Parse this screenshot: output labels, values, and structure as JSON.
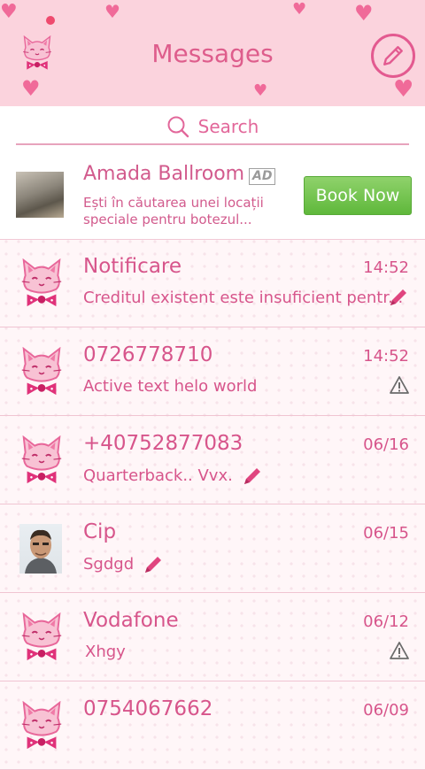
{
  "header": {
    "title": "Messages"
  },
  "search": {
    "placeholder": "Search"
  },
  "ad": {
    "title": "Amada Ballroom",
    "badge": "AD",
    "description": "Ești în căutarea unei locații speciale pentru botezul...",
    "button_label": "Book Now"
  },
  "conversations": [
    {
      "name": "Notificare",
      "time": "14:52",
      "snippet": "Creditul existent este insuficient pentr...",
      "avatar": "cat-avatar",
      "status": "draft-pencil-icon"
    },
    {
      "name": "0726778710",
      "time": "14:52",
      "snippet": "Active text helo world",
      "avatar": "cat-avatar",
      "status": "warning-icon"
    },
    {
      "name": "+40752877083",
      "time": "06/16",
      "snippet": "Quarterback..  Vvx.",
      "avatar": "cat-avatar",
      "status": "draft-pencil-icon"
    },
    {
      "name": "Cip",
      "time": "06/15",
      "snippet": "Sgdgd",
      "avatar": "contact-photo",
      "status": "draft-pencil-icon"
    },
    {
      "name": "Vodafone",
      "time": "06/12",
      "snippet": "Xhgy",
      "avatar": "cat-avatar",
      "status": "warning-icon"
    },
    {
      "name": "0754067662",
      "time": "06/09",
      "snippet": "",
      "avatar": "cat-avatar",
      "status": ""
    }
  ],
  "colors": {
    "accent": "#d7558b",
    "header_bg": "#fbd3dd",
    "button_green": "#6cc04a"
  }
}
